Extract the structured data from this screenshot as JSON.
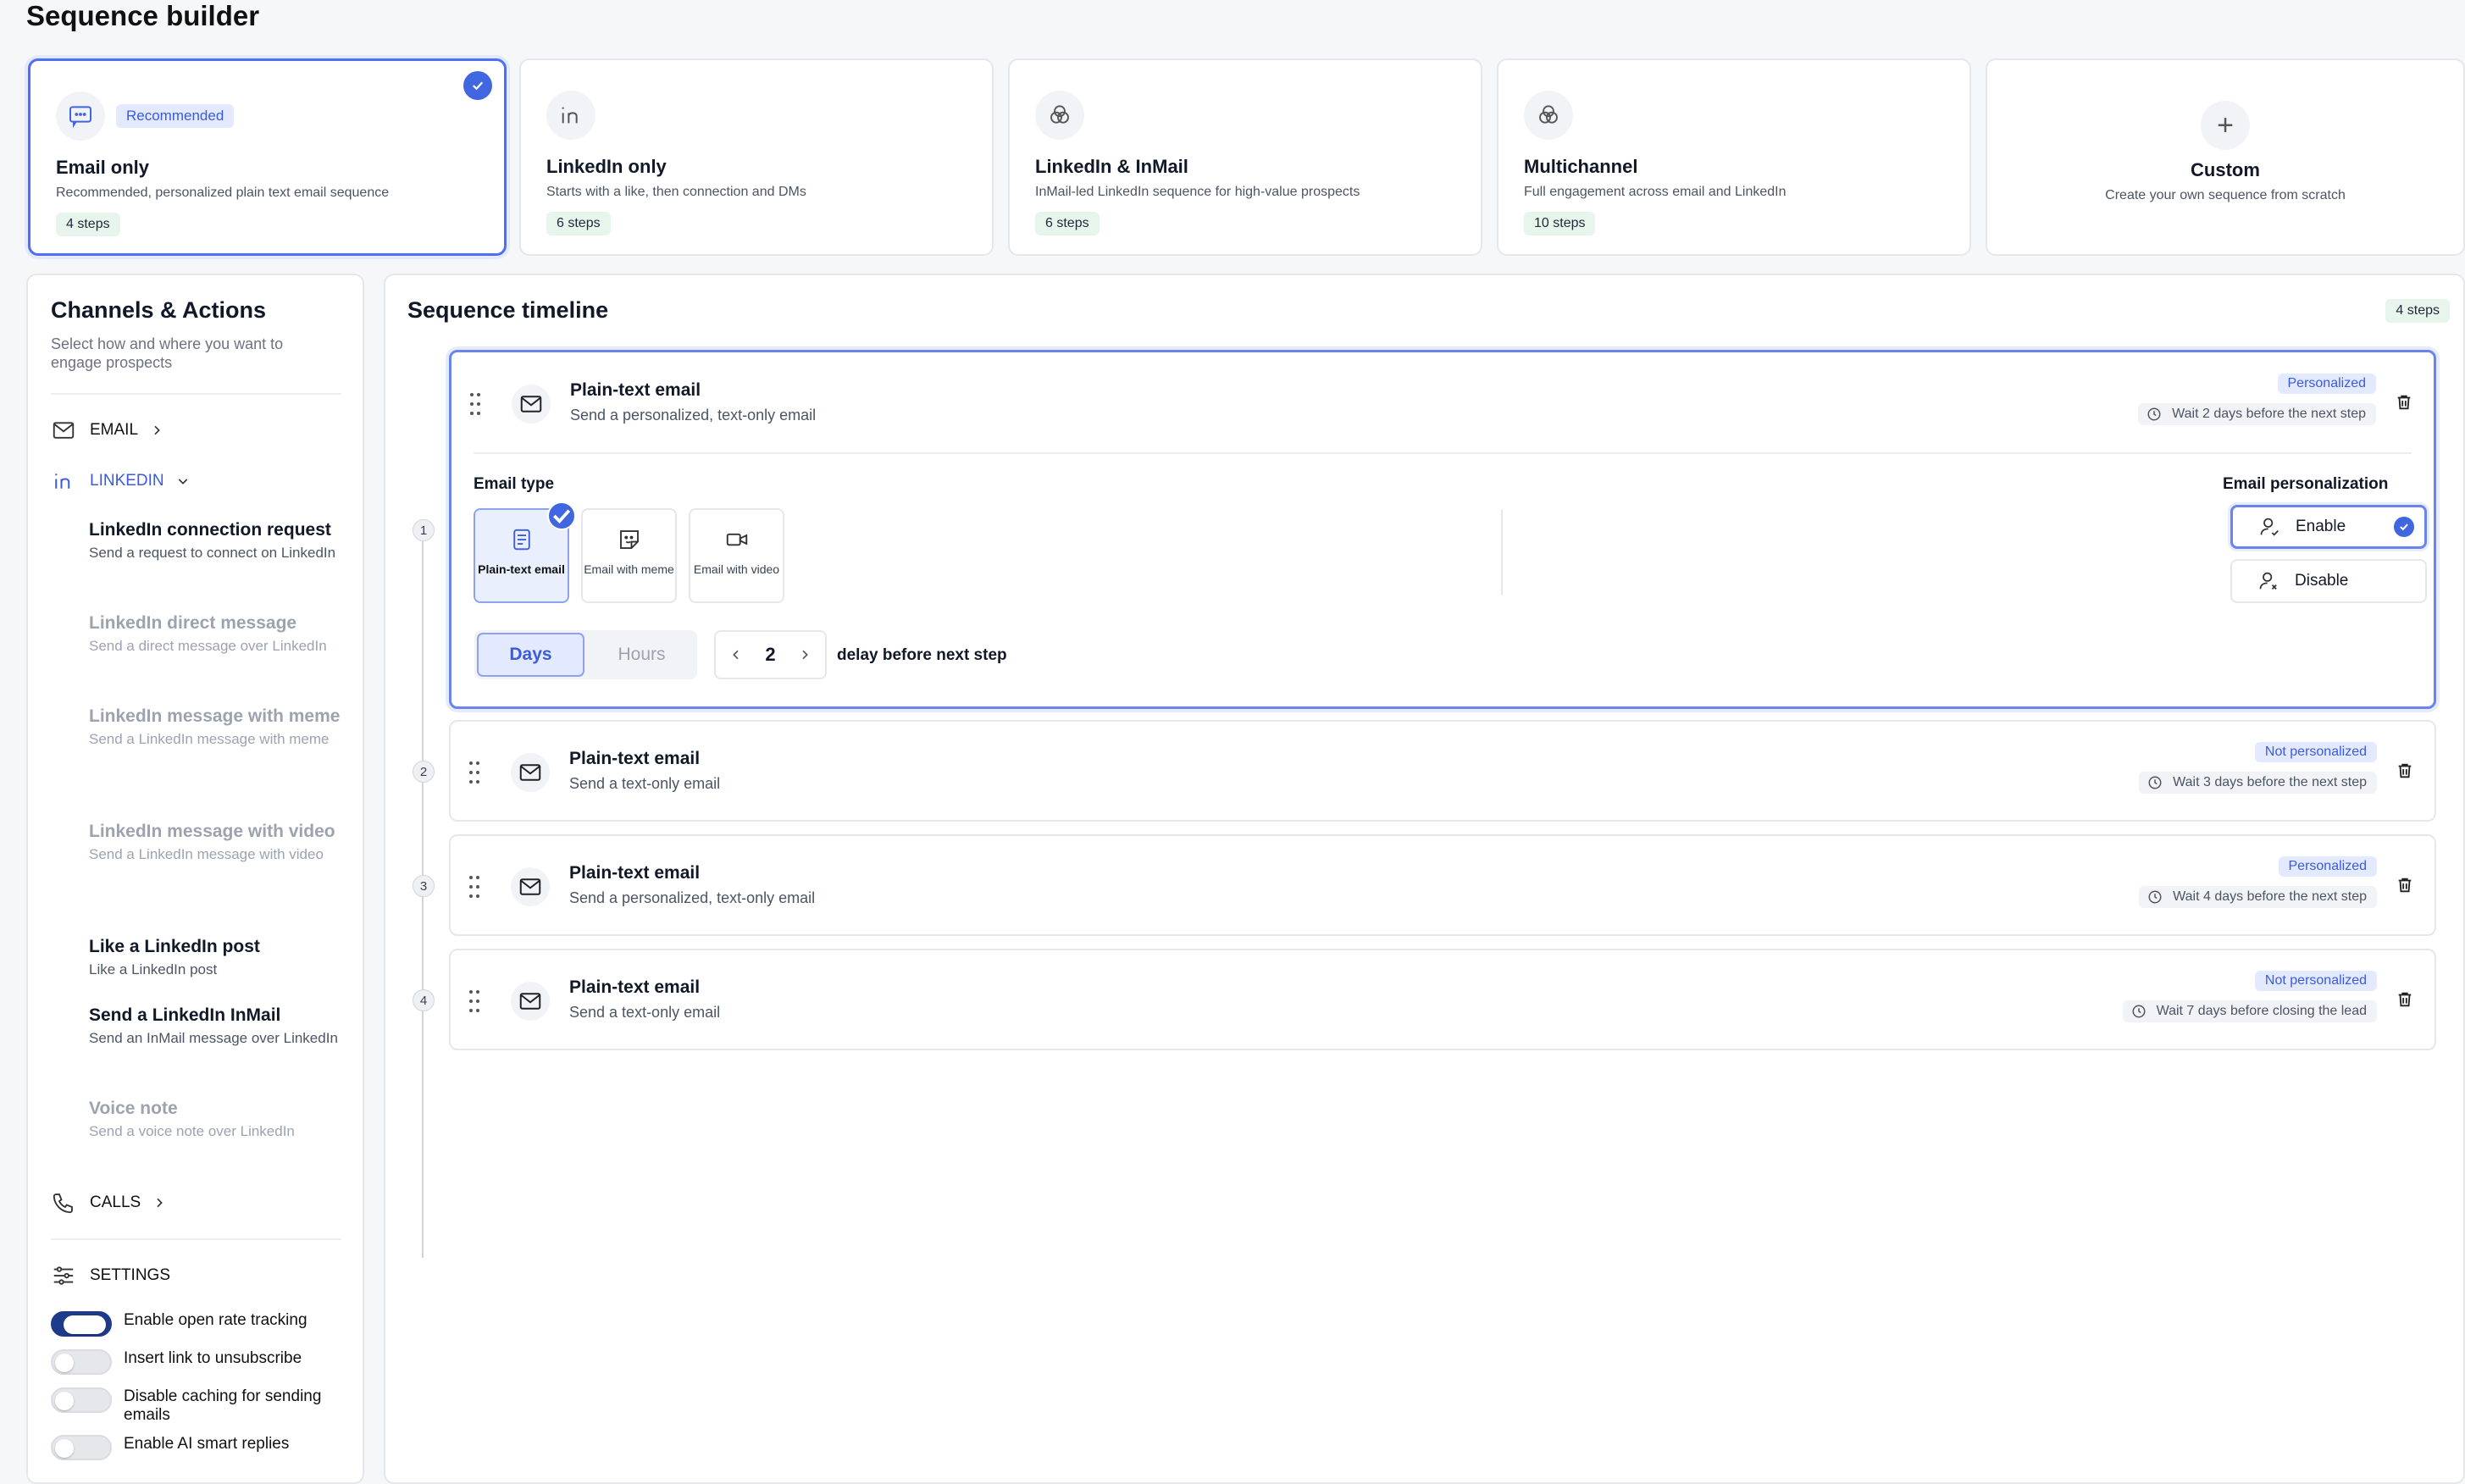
{
  "page_title": "Sequence builder",
  "templates": [
    {
      "name": "Email only",
      "desc": "Recommended, personalized plain text email sequence",
      "steps": "4 steps",
      "badge": "Recommended",
      "icon": "chat-bubble-icon"
    },
    {
      "name": "LinkedIn only",
      "desc": "Starts with a like, then connection and DMs",
      "steps": "6 steps",
      "icon": "linkedin-icon"
    },
    {
      "name": "LinkedIn & InMail",
      "desc": "InMail-led LinkedIn sequence for high-value prospects",
      "steps": "6 steps",
      "icon": "venn-icon"
    },
    {
      "name": "Multichannel",
      "desc": "Full engagement across email and LinkedIn",
      "steps": "10 steps",
      "icon": "venn-icon"
    },
    {
      "name": "Custom",
      "desc": "Create your own sequence from scratch",
      "icon": "plus-icon"
    }
  ],
  "sidebar": {
    "title": "Channels & Actions",
    "subtitle": "Select how and where you want to engage prospects",
    "channels": {
      "email": "EMAIL",
      "linkedin": "LINKEDIN",
      "calls": "CALLS",
      "settings": "SETTINGS"
    },
    "actions": [
      {
        "name": "LinkedIn connection request",
        "desc": "Send a request to connect on LinkedIn"
      },
      {
        "name": "LinkedIn direct message",
        "desc": "Send a direct message over LinkedIn"
      },
      {
        "name": "LinkedIn message with meme",
        "desc": "Send a LinkedIn message with meme"
      },
      {
        "name": "LinkedIn message with video",
        "desc": "Send a LinkedIn message with video"
      },
      {
        "name": "Like a LinkedIn post",
        "desc": "Like a LinkedIn post"
      },
      {
        "name": "Send a LinkedIn InMail",
        "desc": "Send an InMail message over LinkedIn"
      },
      {
        "name": "Voice note",
        "desc": "Send a voice note over LinkedIn"
      }
    ],
    "settings": [
      {
        "label": "Enable open rate tracking",
        "on": true
      },
      {
        "label": "Insert link to unsubscribe",
        "on": false
      },
      {
        "label": "Disable caching for sending emails",
        "on": false
      },
      {
        "label": "Enable AI smart replies",
        "on": false
      }
    ]
  },
  "timeline": {
    "title": "Sequence timeline",
    "steps_badge": "4 steps",
    "steps": [
      {
        "num": "1",
        "title": "Plain-text email",
        "desc": "Send a personalized, text-only email",
        "badge": "Personalized",
        "wait": "Wait 2 days before the next step"
      },
      {
        "num": "2",
        "title": "Plain-text email",
        "desc": "Send a text-only email",
        "badge": "Not personalized",
        "wait": "Wait 3 days before the next step"
      },
      {
        "num": "3",
        "title": "Plain-text email",
        "desc": "Send a personalized, text-only email",
        "badge": "Personalized",
        "wait": "Wait 4 days before the next step"
      },
      {
        "num": "4",
        "title": "Plain-text email",
        "desc": "Send a text-only email",
        "badge": "Not personalized",
        "wait": "Wait 7 days before closing the lead"
      }
    ],
    "editor": {
      "email_type_label": "Email type",
      "types": [
        "Plain-text email",
        "Email with meme",
        "Email with video"
      ],
      "personalization_label": "Email personalization",
      "enable": "Enable",
      "disable": "Disable",
      "unit_days": "Days",
      "unit_hours": "Hours",
      "delay_value": "2",
      "delay_label": "delay before next step"
    }
  },
  "colors": {
    "accent": "#4066e0",
    "accent_light": "#e3e9fe",
    "green_badge": "#e8f5ec",
    "toggle_on": "#1e3a8a"
  }
}
